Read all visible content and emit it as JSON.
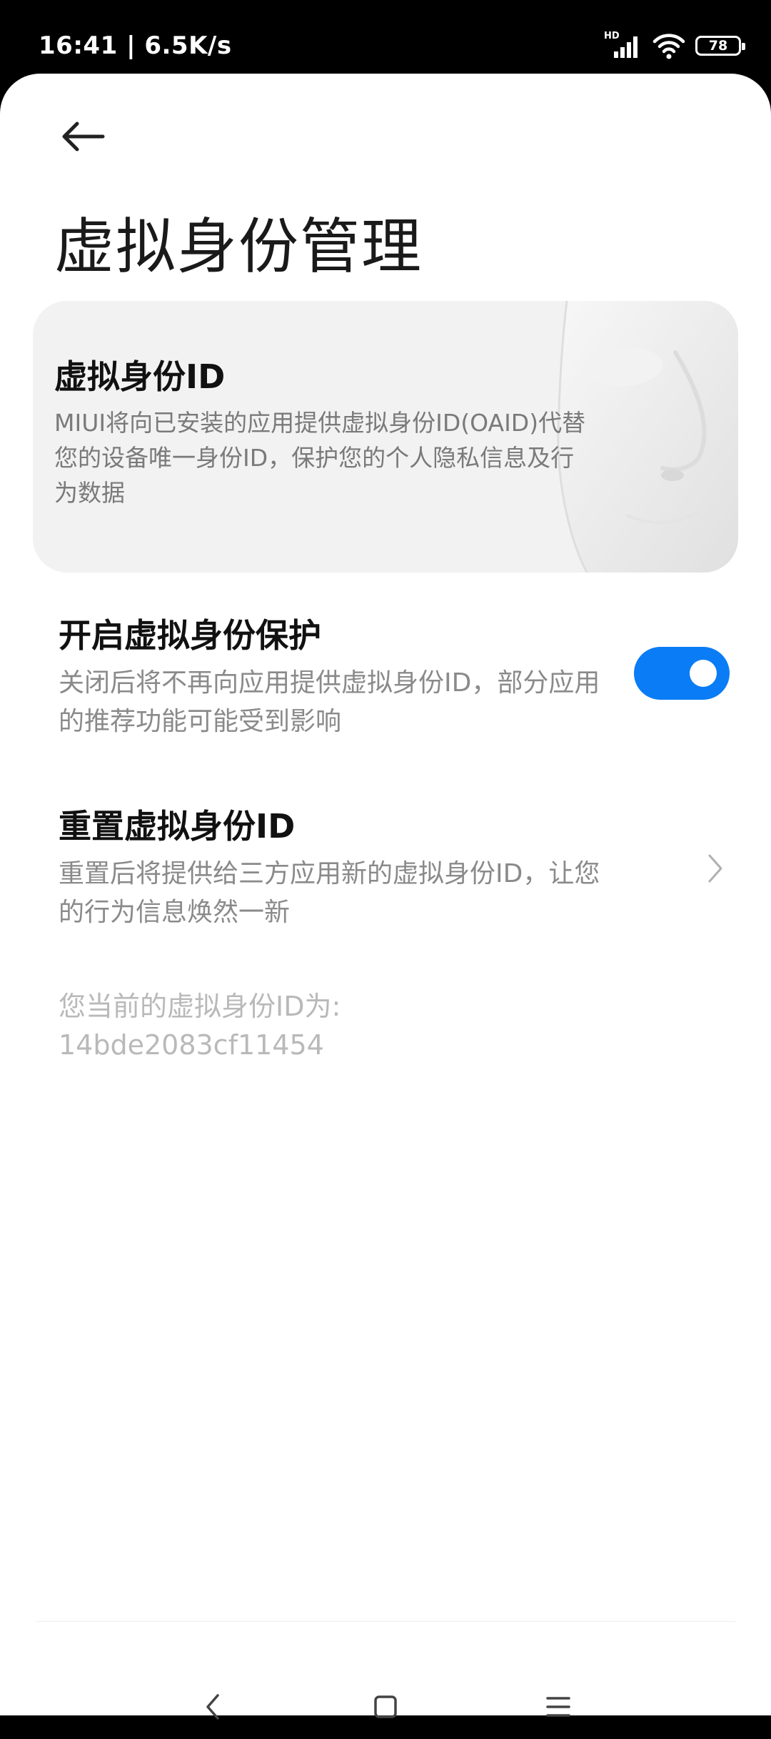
{
  "status_bar": {
    "time": "16:41",
    "separator": "|",
    "speed": "6.5K/s",
    "hd_label": "HD",
    "battery_level": "78",
    "icons": [
      "hd-signal-icon",
      "wifi-icon",
      "battery-icon"
    ]
  },
  "header": {
    "back_icon": "back-arrow-icon",
    "title": "虚拟身份管理"
  },
  "banner": {
    "title": "虚拟身份ID",
    "description": "MIUI将向已安装的应用提供虚拟身份ID(OAID)代替您的设备唯一身份ID，保护您的个人隐私信息及行为数据",
    "image": "mask-illustration"
  },
  "settings": {
    "protection": {
      "title": "开启虚拟身份保护",
      "description": "关闭后将不再向应用提供虚拟身份ID，部分应用的推荐功能可能受到影响",
      "enabled": true
    },
    "reset": {
      "title": "重置虚拟身份ID",
      "description": "重置后将提供给三方应用新的虚拟身份ID，让您的行为信息焕然一新",
      "icon": "chevron-right-icon"
    }
  },
  "current_id": {
    "label": "您当前的虚拟身份ID为:",
    "value": "14bde2083cf11454"
  },
  "nav_bar": {
    "back_icon": "nav-back-icon",
    "home_icon": "nav-home-icon",
    "recents_icon": "nav-recents-icon"
  },
  "colors": {
    "accent": "#0a7cf5",
    "banner_bg": "#f2f2f2",
    "secondary_text": "#8a8a8a",
    "muted_text": "#b9b9b9"
  }
}
